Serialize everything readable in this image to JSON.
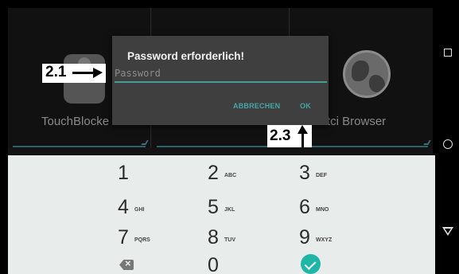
{
  "launcher": {
    "apps": [
      {
        "label": "TouchBlocke",
        "icon": "hand-touch-icon"
      },
      {
        "label": "",
        "icon": ""
      },
      {
        "label": "tci Browser",
        "icon": "globe-icon"
      }
    ]
  },
  "dialog": {
    "title": "Password erforderlich!",
    "password_placeholder": "Password",
    "password_value": "",
    "cancel_label": "ABBRECHEN",
    "ok_label": "OK",
    "accent_color": "#4a9a96"
  },
  "annotations": {
    "input_marker": "2.1",
    "ok_marker": "2.3"
  },
  "keypad": {
    "keys": [
      {
        "digit": "1",
        "letters": ""
      },
      {
        "digit": "2",
        "letters": "ABC"
      },
      {
        "digit": "3",
        "letters": "DEF"
      },
      {
        "digit": "4",
        "letters": "GHI"
      },
      {
        "digit": "5",
        "letters": "JKL"
      },
      {
        "digit": "6",
        "letters": "MNO"
      },
      {
        "digit": "7",
        "letters": "PQRS"
      },
      {
        "digit": "8",
        "letters": "TUV"
      },
      {
        "digit": "9",
        "letters": "WXYZ"
      },
      {
        "digit": "0",
        "letters": ""
      }
    ],
    "backspace_icon": "backspace-icon",
    "done_icon": "checkmark-icon",
    "done_color": "#1fb6a8"
  },
  "navbar": {
    "icons": [
      "recents-icon",
      "home-icon",
      "back-icon"
    ]
  }
}
